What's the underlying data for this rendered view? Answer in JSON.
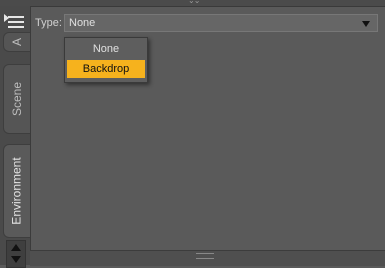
{
  "sidebar": {
    "tabs": [
      {
        "label": "A"
      },
      {
        "label": "Scene"
      },
      {
        "label": "Environment",
        "active": true
      }
    ]
  },
  "pane": {
    "type_label": "Type:",
    "type_value": "None",
    "dropdown": {
      "options": [
        "None",
        "Backdrop"
      ],
      "highlighted": "Backdrop"
    }
  },
  "colors": {
    "highlight": "#f6b21d",
    "background": "#5a5a5a"
  },
  "icons": {
    "menu": "menu-icon",
    "dropdown_caret": "chevron-down-icon",
    "scroll_up": "arrow-up-icon",
    "scroll_down": "arrow-down-icon"
  }
}
